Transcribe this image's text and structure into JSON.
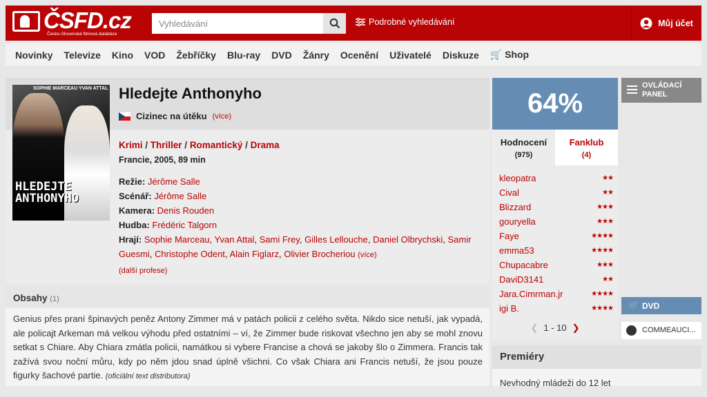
{
  "header": {
    "logo_text": "ČSFD.cz",
    "logo_sub": "Česko-Slovenská filmová databáze",
    "search_placeholder": "Vyhledávání",
    "advanced_search": "Podrobné vyhledávání",
    "account": "Můj účet"
  },
  "nav": [
    "Novinky",
    "Televize",
    "Kino",
    "VOD",
    "Žebříčky",
    "Blu-ray",
    "DVD",
    "Žánry",
    "Ocenění",
    "Uživatelé",
    "Diskuze",
    "Shop"
  ],
  "film": {
    "poster_names": "SOPHIE MARCEAU   YVAN ATTAL",
    "poster_title": "HLEDEJTE ANTHONYHO",
    "title": "Hledejte Anthonyho",
    "orig_title": "Cizinec na útěku",
    "orig_more": "(více)",
    "genres": [
      "Krimi",
      "Thriller",
      "Romantický",
      "Drama"
    ],
    "origin": "Francie, 2005, 89 min",
    "directing_label": "Režie:",
    "directing": "Jérôme Salle",
    "writing_label": "Scénář:",
    "writing": "Jérôme Salle",
    "camera_label": "Kamera:",
    "camera": "Denis Rouden",
    "music_label": "Hudba:",
    "music": "Frédéric Talgorn",
    "cast_label": "Hrají:",
    "cast": [
      "Sophie Marceau",
      "Yvan Attal",
      "Sami Frey",
      "Gilles Lellouche",
      "Daniel Olbrychski",
      "Samir Guesmi",
      "Christophe Odent",
      "Alain Figlarz",
      "Olivier Brocheriou"
    ],
    "cast_more": "(více)",
    "more_professions": "(další profese)"
  },
  "plot": {
    "heading": "Obsahy",
    "count": "(1)",
    "text": "Genius přes praní špinavých peněz Antony Zimmer má v patách policii z celého světa. Nikdo sice netuší, jak vypadá, ale policajt Arkeman má velkou výhodu před ostatními – ví, že Zimmer bude riskovat všechno jen aby se mohl znovu setkat s Chiare. Aby Chiara zmátla policii, namátkou si vybere Francise a chová se jakoby šlo o Zimmera. Francis tak zažívá svou noční můru, kdy po něm jdou snad úplně všichni. Co však Chiara ani Francis netuší, že jsou pouze figurky šachové partie.",
    "source": "(oficiální text distributora)"
  },
  "rating": {
    "percent": "64%",
    "tab1_label": "Hodnocení",
    "tab1_count": "(975)",
    "tab2_label": "Fanklub",
    "tab2_count": "(4)",
    "raters": [
      {
        "name": "kleopatra",
        "stars": 2
      },
      {
        "name": "Cival",
        "stars": 2
      },
      {
        "name": "Blizzard",
        "stars": 3
      },
      {
        "name": "gouryella",
        "stars": 3
      },
      {
        "name": "Faye",
        "stars": 4
      },
      {
        "name": "emma53",
        "stars": 4
      },
      {
        "name": "Chupacabre",
        "stars": 3
      },
      {
        "name": "DaviD3141",
        "stars": 2
      },
      {
        "name": "Jara.Cimrman.jr",
        "stars": 4
      },
      {
        "name": "igi B.",
        "stars": 4
      }
    ],
    "pager": "1 - 10"
  },
  "sidebar": {
    "panel": "OVLÁDACÍ PANEL",
    "dvd": "DVD",
    "comm": "COMMEAUCI..."
  },
  "premiery": {
    "heading": "Premiéry",
    "text": "Nevhodný mládeži do 12 let"
  },
  "colors": {
    "brand": "#ba0305",
    "rating": "#658db4"
  }
}
